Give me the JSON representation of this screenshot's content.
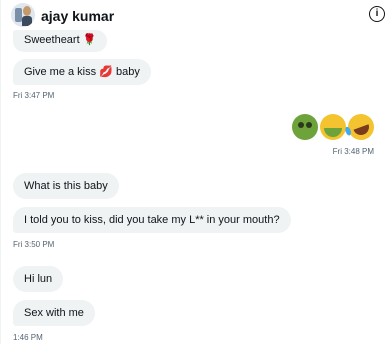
{
  "header": {
    "contact_name": "ajay kumar",
    "info_icon": "info-icon"
  },
  "messages": [
    {
      "text": "Sweetheart",
      "emoji": "🌹"
    },
    {
      "text_before": "Give me a kiss",
      "emoji": "💋",
      "text_after": "baby"
    },
    {
      "time": "Fri 3:47 PM"
    },
    {
      "emojis": [
        "🤢",
        "🤮",
        "🤣"
      ],
      "time": "Fri 3:48 PM"
    },
    {
      "text": "What is this baby"
    },
    {
      "text": "I told you to kiss, did you take my L** in your mouth?"
    },
    {
      "time": "Fri 3:50 PM"
    },
    {
      "text": "Hi lun"
    },
    {
      "text": "Sex with me"
    },
    {
      "time": "1:46 PM"
    }
  ]
}
